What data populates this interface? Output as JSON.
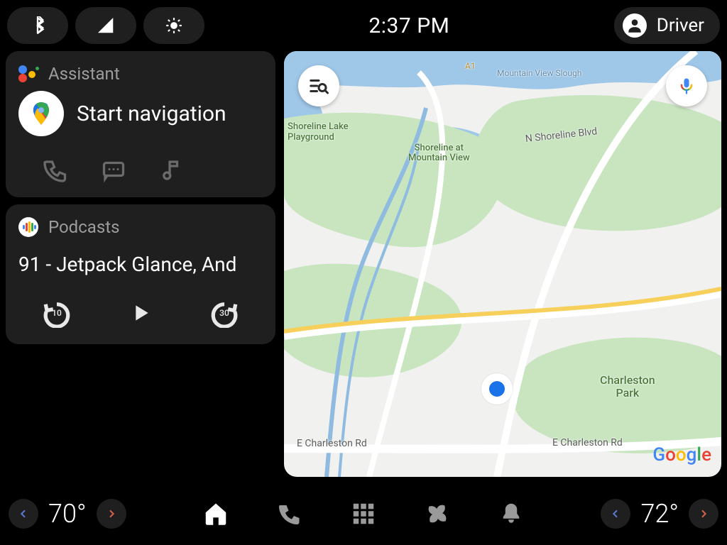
{
  "status": {
    "time": "2:37 PM",
    "profile_name": "Driver"
  },
  "assistant_card": {
    "header": "Assistant",
    "primary": "Start navigation"
  },
  "podcasts_card": {
    "header": "Podcasts",
    "episode": "91 - Jetpack Glance, And",
    "rewind_seconds": "10",
    "forward_seconds": "30"
  },
  "map": {
    "attribution": "Google",
    "labels": {
      "route_a1": "A1",
      "slough": "Mountain View Slough",
      "shoreline_lake": "Shoreline Lake",
      "playground": "Playground",
      "shoreline": "Shoreline at\nMountain View",
      "n_shoreline": "N Shoreline Blvd",
      "charleston_park": "Charleston\nPark",
      "e_charleston_l": "E Charleston Rd",
      "e_charleston_r": "E Charleston Rd"
    }
  },
  "climate": {
    "left_temp": "70°",
    "right_temp": "72°"
  }
}
